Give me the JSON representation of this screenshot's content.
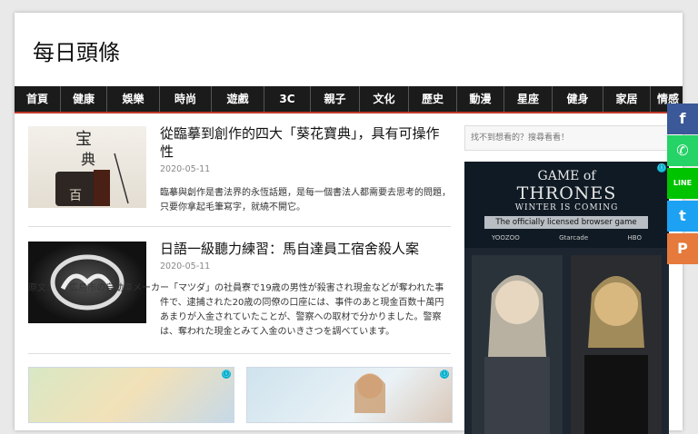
{
  "site": {
    "title": "每日頭條"
  },
  "nav": {
    "items": [
      "首頁",
      "健康",
      "娛樂",
      "時尚",
      "遊戲",
      "3C",
      "親子",
      "文化",
      "歷史",
      "動漫",
      "星座",
      "健身",
      "家居",
      "情感"
    ]
  },
  "articles": [
    {
      "title": "從臨摹到創作的四大「葵花寶典」，具有可操作性",
      "date": "2020-05-11",
      "excerpt": "臨摹與創作是書法界的永恆話題，是每一個書法人都需要去思考的問題，只要你拿起毛筆寫字，就繞不開它。",
      "thumb_text": "百"
    },
    {
      "title": "日語一級聽力練習：馬自達員工宿舍殺人案",
      "date": "2020-05-11",
      "excerpt": "原文：　　広島市の自動車メーカー「マツダ」の社員寮で19歳の男性が殺害され現金などが奪われた事件で、逮捕された20歳の同僚の口座には、事件のあと現金百数十萬円あまりが入金されていたことが、警察への取材で分かりました。警察は、奪われた現金とみて入金のいきさつを調べています。"
    }
  ],
  "sidebar": {
    "search_placeholder": "找不到想看的？搜尋看看！",
    "ad": {
      "title_line1": "GAME of",
      "title_line2": "THRONES",
      "subtitle1": "WINTER IS COMING",
      "subtitle2": "The officially licensed browser game",
      "brands": [
        "YOOZOO",
        "Gtarcade",
        "HBO"
      ]
    }
  },
  "ads": {
    "choice_icon": "ⓘ"
  },
  "share": [
    {
      "name": "facebook",
      "glyph": "f",
      "color": "#3b5998"
    },
    {
      "name": "whatsapp",
      "glyph": "✆",
      "color": "#25d366"
    },
    {
      "name": "line",
      "glyph": "LINE",
      "color": "#00c300"
    },
    {
      "name": "twitter",
      "glyph": "t",
      "color": "#1da1f2"
    },
    {
      "name": "plurk",
      "glyph": "P",
      "color": "#e57a3c"
    }
  ]
}
